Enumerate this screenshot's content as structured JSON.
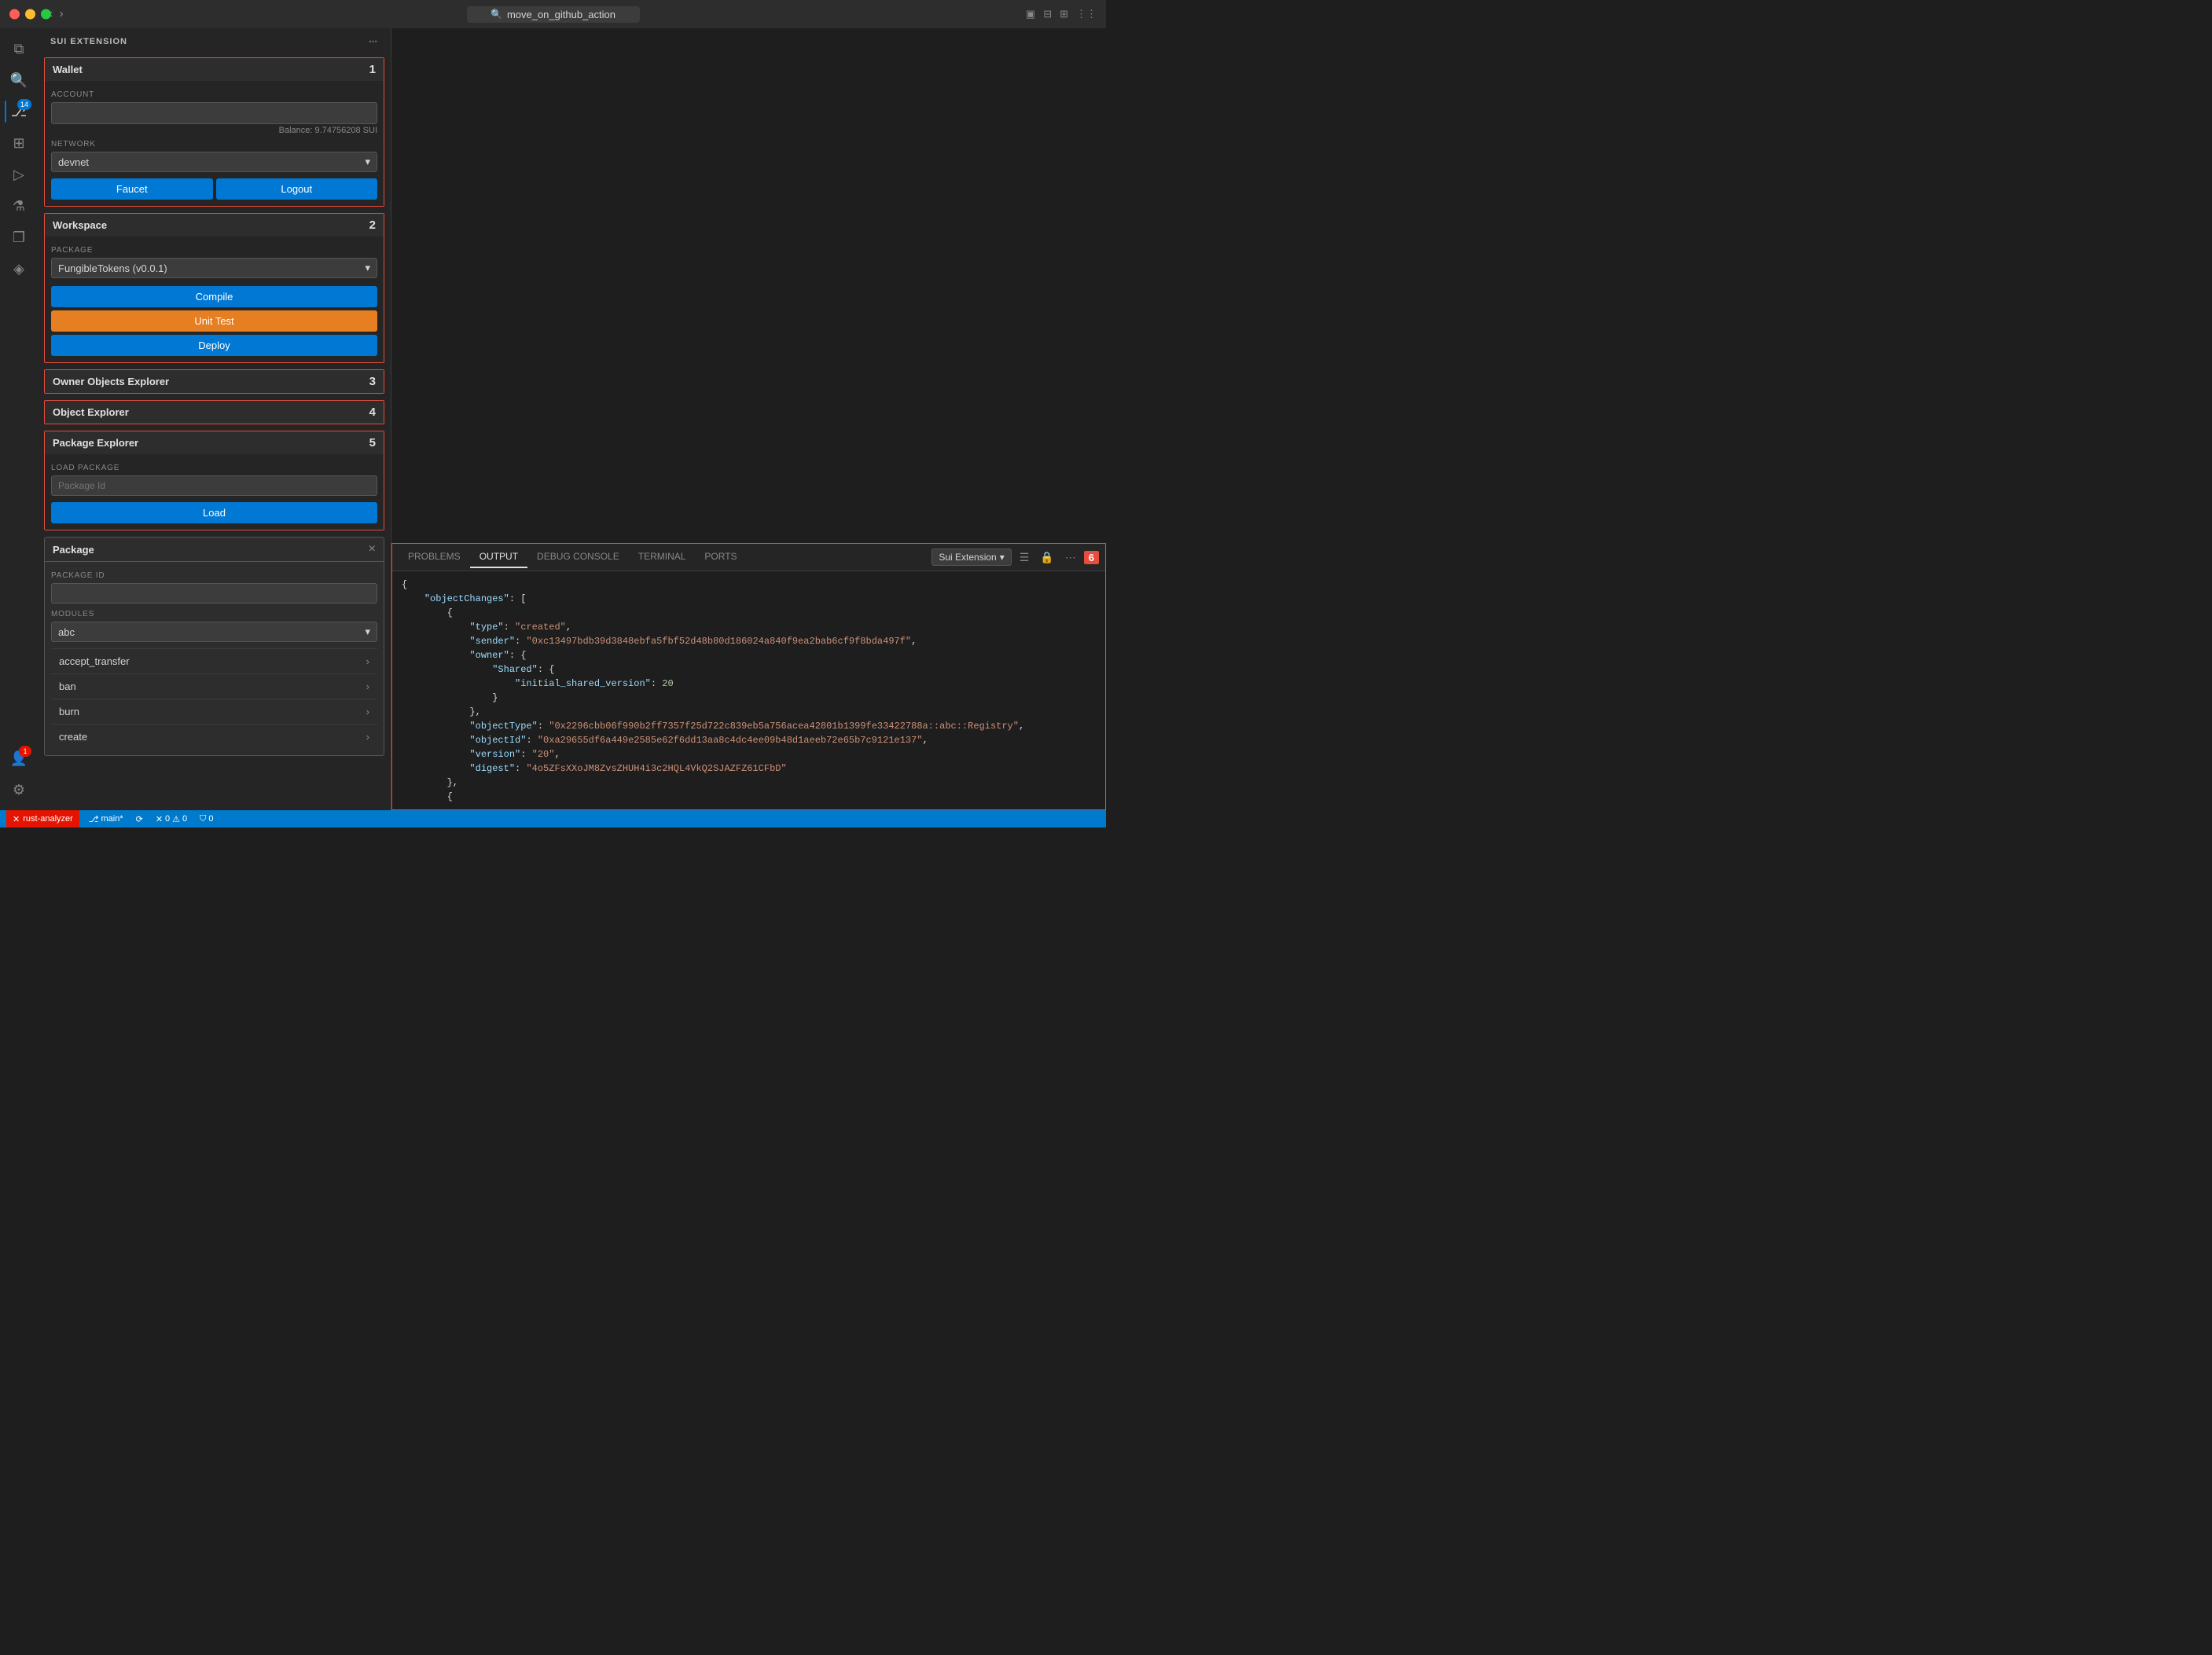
{
  "titlebar": {
    "nav_back": "‹",
    "nav_forward": "›",
    "search_placeholder": "move_on_github_action",
    "search_icon": "🔍"
  },
  "activity_bar": {
    "icons": [
      {
        "name": "explorer-icon",
        "symbol": "⧉",
        "active": false
      },
      {
        "name": "search-icon",
        "symbol": "🔍",
        "active": false
      },
      {
        "name": "source-control-icon",
        "symbol": "⎇",
        "active": true,
        "badge": "14"
      },
      {
        "name": "extensions-icon",
        "symbol": "⊞",
        "active": false
      },
      {
        "name": "run-icon",
        "symbol": "▷",
        "active": false
      },
      {
        "name": "flask-icon",
        "symbol": "⚗",
        "active": false
      },
      {
        "name": "copy-icon",
        "symbol": "❐",
        "active": false
      },
      {
        "name": "sui-icon",
        "symbol": "◈",
        "active": false
      }
    ],
    "bottom_icons": [
      {
        "name": "account-icon",
        "symbol": "👤",
        "badge_red": "1"
      },
      {
        "name": "settings-icon",
        "symbol": "⚙"
      }
    ]
  },
  "sidebar": {
    "header": "SUI EXTENSION",
    "panels": {
      "wallet": {
        "title": "Wallet",
        "number": "1",
        "account_label": "ACCOUNT",
        "balance": "Balance: 9.74756208 SUI",
        "network_label": "NETWORK",
        "network_value": "devnet",
        "faucet_btn": "Faucet",
        "logout_btn": "Logout"
      },
      "workspace": {
        "title": "Workspace",
        "number": "2",
        "package_label": "PACKAGE",
        "package_value": "FungibleTokens (v0.0.1)",
        "compile_btn": "Compile",
        "unit_test_btn": "Unit Test",
        "deploy_btn": "Deploy"
      },
      "owner_objects": {
        "title": "Owner Objects Explorer",
        "number": "3"
      },
      "object_explorer": {
        "title": "Object Explorer",
        "number": "4"
      },
      "package_explorer": {
        "title": "Package Explorer",
        "number": "5",
        "load_package_label": "Load Package",
        "package_id_placeholder": "Package Id",
        "load_btn": "Load"
      }
    },
    "package_popup": {
      "title": "Package",
      "close_label": "×",
      "package_id_label": "Package Id",
      "package_id_value": "",
      "modules_label": "Modules",
      "modules_value": "abc",
      "methods": [
        {
          "name": "accept_transfer"
        },
        {
          "name": "ban"
        },
        {
          "name": "burn"
        },
        {
          "name": "create"
        }
      ]
    }
  },
  "bottom_panel": {
    "tabs": [
      {
        "label": "PROBLEMS",
        "active": false
      },
      {
        "label": "OUTPUT",
        "active": true
      },
      {
        "label": "DEBUG CONSOLE",
        "active": false
      },
      {
        "label": "TERMINAL",
        "active": false
      },
      {
        "label": "PORTS",
        "active": false
      }
    ],
    "source_select": "Sui Extension",
    "number_badge": "6",
    "output": {
      "lines": [
        "{",
        "    \"objectChanges\": [",
        "        {",
        "            \"type\": \"created\",",
        "            \"sender\": \"0xc13497bdb39d3848ebfa5fbf52d48b80d186024a840f9ea2bab6cf9f8bda497f\",",
        "            \"owner\": {",
        "                \"Shared\": {",
        "                    \"initial_shared_version\": 20",
        "                }",
        "            },",
        "            \"objectType\": \"0x2296cbb06f990b2ff7357f25d722c839eb5a756acea42801b1399fe33422788a::abc::Registry\",",
        "            \"objectId\": \"0xa29655df6a449e2585e62f6dd13aa8c4dc4ee09b48d1aeeb72e65b7c9121e137\",",
        "            \"version\": \"20\",",
        "            \"digest\": \"4o5ZFsXXoJM8ZvsZHUH4i3c2HQL4VkQ2SJAZFZ61CFbD\"",
        "        },",
        "        {"
      ]
    }
  },
  "status_bar": {
    "branch": "main*",
    "sync": "⟳",
    "warnings": "⚠ 0",
    "errors_zero": "✕ 0",
    "ports": "⛉ 0",
    "rust_analyzer": "rust-analyzer",
    "error_badge": "✕"
  }
}
